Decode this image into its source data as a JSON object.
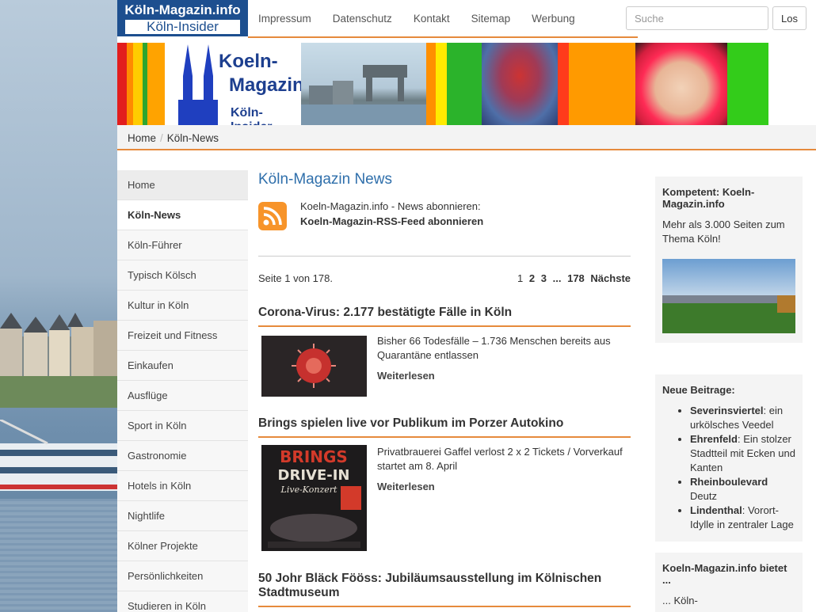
{
  "logo": {
    "line1": "Köln-Magazin.info",
    "line2": "Köln-Insider"
  },
  "nav": [
    "Impressum",
    "Datenschutz",
    "Kontakt",
    "Sitemap",
    "Werbung"
  ],
  "search": {
    "placeholder": "Suche",
    "button": "Los"
  },
  "banner": {
    "line1": "Koeln-",
    "line2": "Magazin.info",
    "line3": "Köln-Insider"
  },
  "breadcrumb": {
    "home": "Home",
    "current": "Köln-News"
  },
  "sidebar": {
    "items": [
      "Home",
      "Köln-News",
      "Köln-Führer",
      "Typisch Kölsch",
      "Kultur in Köln",
      "Freizeit und Fitness",
      "Einkaufen",
      "Ausflüge",
      "Sport in Köln",
      "Gastronomie",
      "Hotels in Köln",
      "Nightlife",
      "Kölner Projekte",
      "Persönlichkeiten",
      "Studieren in Köln"
    ]
  },
  "main": {
    "title": "Köln-Magazin News",
    "rss_line1": "Koeln-Magazin.info - News abonnieren:",
    "rss_line2": "Koeln-Magazin-RSS-Feed abonnieren",
    "page_info": "Seite 1 von 178.",
    "pager": {
      "p1": "1",
      "p2": "2",
      "p3": "3",
      "dots": "...",
      "last": "178",
      "next": "Nächste"
    },
    "articles": [
      {
        "title": "Corona-Virus: 2.177 bestätigte Fälle in Köln",
        "text": "Bisher 66 Todesfälle – 1.736 Menschen bereits aus Quarantäne entlassen",
        "more": "Weiterlesen"
      },
      {
        "title": "Brings spielen live vor Publikum im Porzer Autokino",
        "text": "Privatbrauerei Gaffel verlost 2 x 2 Tickets / Vorverkauf startet am 8. April",
        "more": "Weiterlesen",
        "poster_line1": "BRINGS",
        "poster_line2": "DRIVE-IN",
        "poster_line3": "Live-Konzert"
      },
      {
        "title": "50 Johr Bläck Fööss: Jubiläumsausstellung im Kölnischen Stadtmuseum"
      }
    ]
  },
  "right": {
    "box1": {
      "title": "Kompetent: Koeln-Magazin.info",
      "text": "Mehr als 3.000 Seiten zum Thema Köln!"
    },
    "box2": {
      "title": "Neue Beitrage:",
      "items": [
        {
          "bold": "Severinsviertel",
          "rest": ": ein urkölsches Veedel"
        },
        {
          "bold": "Ehrenfeld",
          "rest": ": Ein stolzer Stadtteil mit Ecken und Kanten"
        },
        {
          "bold": "Rheinboulevard",
          "rest": " Deutz"
        },
        {
          "bold": "Lindenthal",
          "rest": ": Vorort-Idylle in zentraler Lage"
        }
      ]
    },
    "box3": {
      "title": "Koeln-Magazin.info bietet ...",
      "text": "... Köln-"
    }
  },
  "colors": {
    "accent": "#e68a3c",
    "link": "#2f6fab",
    "logo": "#1d4f8f"
  }
}
